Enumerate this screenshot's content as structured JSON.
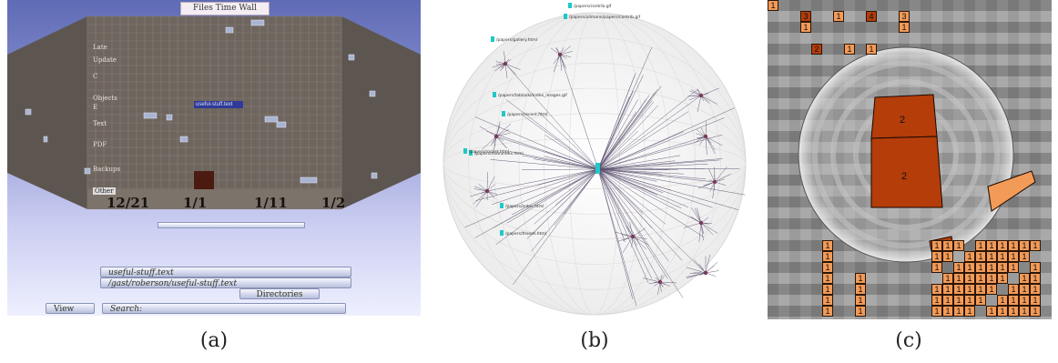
{
  "colors": {
    "sky_top": "#5f6bb5",
    "wall": "#6d655e",
    "highlight_blue": "#2e3a9a",
    "dark_block": "#4b1a10",
    "hyperbolic_cyan": "#20c8c8",
    "node_purple": "#7a3a5a",
    "grid_orange": "#f29a57",
    "focus_dark_orange": "#b43d0a"
  },
  "captions": {
    "a": "(a)",
    "b": "(b)",
    "c": "(c)"
  },
  "panel_a": {
    "title": "Files Time Wall",
    "categories": [
      "Late",
      "Update",
      "C",
      "Objects",
      "E",
      "Text",
      "PDF",
      "Backups",
      "Other"
    ],
    "highlight_label": "useful-stuff.text",
    "dates": [
      "12/21",
      "1/1",
      "1/11",
      "1/2"
    ],
    "slider_label": "",
    "field_1": "useful-stuff.text",
    "field_2": "/gast/roberson/useful-stuff.text",
    "directories_button": "Directories",
    "view_button": "View",
    "search_label": "Search:"
  },
  "panel_b": {
    "labels": [
      "/papers/contrib.gif",
      "/papers/ullmann/papers/contrib.gif",
      "/papers/gallery.html",
      "/papers/tabloids/index_images.gif",
      "/papers/recent.html",
      "/papers/rocket.html",
      "/papers/mainindex.html",
      "/papers/index.html",
      "/papers/theses.html"
    ]
  },
  "panel_c": {
    "focus_values": [
      "2",
      "2"
    ],
    "side_numbers": [
      "1",
      "3",
      "1",
      "1",
      "4",
      "3",
      "1",
      "2",
      "1",
      "1"
    ]
  }
}
